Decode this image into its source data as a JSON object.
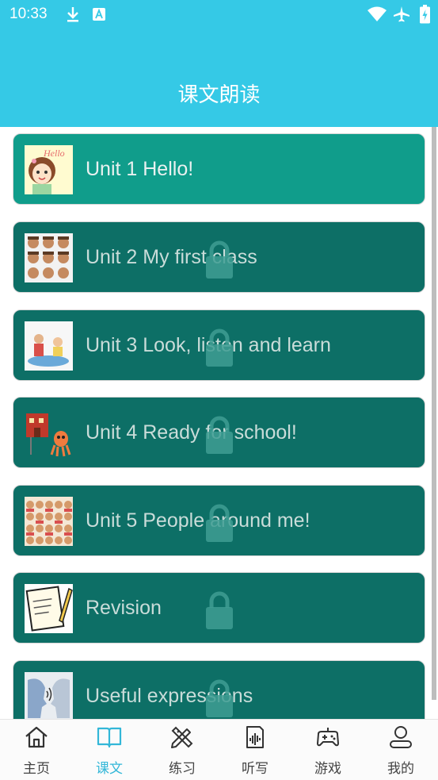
{
  "status_bar": {
    "time": "10:33"
  },
  "app_bar": {
    "title": "课文朗读"
  },
  "lessons": [
    {
      "label": "Unit 1 Hello!",
      "thumb_text": "Hello"
    },
    {
      "label": "Unit 2 My first class"
    },
    {
      "label": "Unit 3 Look, listen and learn"
    },
    {
      "label": "Unit 4 Ready for school!"
    },
    {
      "label": "Unit 5 People around me!"
    },
    {
      "label": "Revision"
    },
    {
      "label": "Useful expressions"
    }
  ],
  "tabs": [
    {
      "label": "主页"
    },
    {
      "label": "课文"
    },
    {
      "label": "练习"
    },
    {
      "label": "听写"
    },
    {
      "label": "游戏"
    },
    {
      "label": "我的"
    }
  ],
  "colors": {
    "header": "#35c9e6",
    "card_active": "#109d8b",
    "card_locked": "#0d6f66",
    "tab_active": "#33b7d8"
  }
}
